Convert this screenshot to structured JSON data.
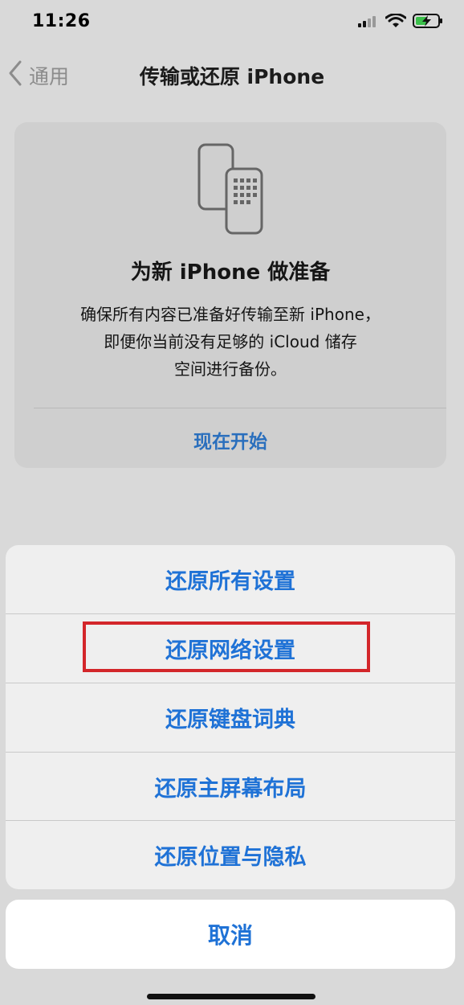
{
  "status_bar": {
    "time": "11:26",
    "icons": [
      "signal-icon",
      "wifi-icon",
      "battery-charging-icon"
    ]
  },
  "nav": {
    "back_label": "通用",
    "title": "传输或还原 iPhone"
  },
  "card": {
    "icon": "phones-transfer-icon",
    "title": "为新 iPhone 做准备",
    "desc_lines": [
      "确保所有内容已准备好传输至新 iPhone，",
      "即便你当前没有足够的 iCloud 储存",
      "空间进行备份。"
    ],
    "action_label": "现在开始"
  },
  "action_sheet": {
    "items": [
      "还原所有设置",
      "还原网络设置",
      "还原键盘词典",
      "还原主屏幕布局",
      "还原位置与隐私"
    ],
    "highlighted_index": 1,
    "cancel_label": "取消"
  },
  "colors": {
    "accent": "#1f72d6",
    "highlight": "#d3262a"
  }
}
